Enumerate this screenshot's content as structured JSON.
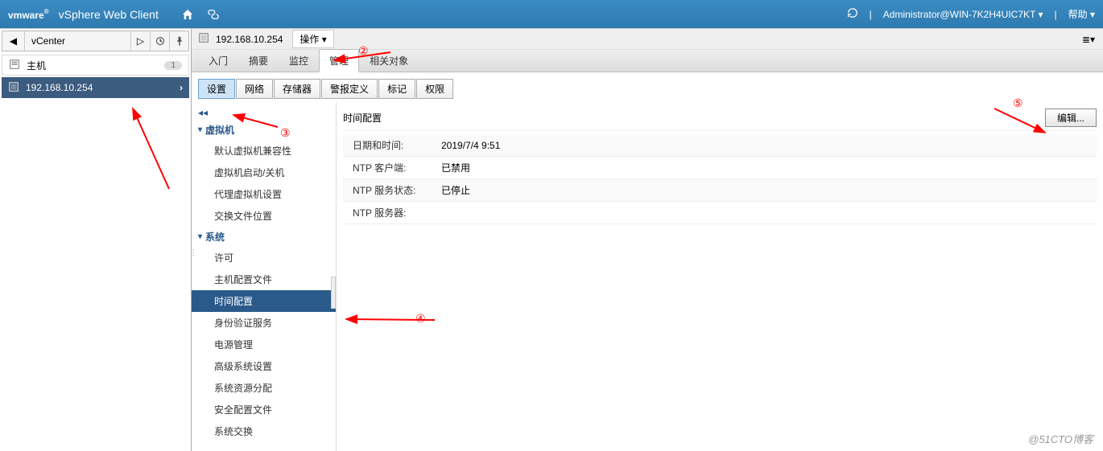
{
  "header": {
    "logo": "vmware",
    "product": "vSphere Web Client",
    "user": "Administrator@WIN-7K2H4UIC7KT",
    "help": "帮助"
  },
  "sidebar": {
    "nav_context": "vCenter",
    "host_label": "主机",
    "host_count": "1",
    "selected_ip": "192.168.10.254"
  },
  "content": {
    "host_ip": "192.168.10.254",
    "actions_label": "操作",
    "main_tabs": {
      "getting_started": "入门",
      "summary": "摘要",
      "monitor": "监控",
      "manage": "管理",
      "related": "相关对象"
    },
    "sub_tabs": {
      "settings": "设置",
      "networking": "网络",
      "storage": "存储器",
      "alarm": "警报定义",
      "tags": "标记",
      "permissions": "权限"
    }
  },
  "settings_nav": {
    "vm_group": "虚拟机",
    "vm_items": {
      "default_compat": "默认虚拟机兼容性",
      "startup": "虚拟机启动/关机",
      "agent": "代理虚拟机设置",
      "swap": "交换文件位置"
    },
    "sys_group": "系统",
    "sys_items": {
      "licensing": "许可",
      "host_profile": "主机配置文件",
      "time_config": "时间配置",
      "auth_services": "身份验证服务",
      "power_mgmt": "电源管理",
      "advanced": "高级系统设置",
      "resource_alloc": "系统资源分配",
      "security_profile": "安全配置文件",
      "system_swap": "系统交换"
    }
  },
  "detail": {
    "title": "时间配置",
    "edit_label": "编辑...",
    "rows": {
      "datetime_label": "日期和时间:",
      "datetime_value": "2019/7/4 9:51",
      "ntp_client_label": "NTP 客户端:",
      "ntp_client_value": "已禁用",
      "ntp_status_label": "NTP 服务状态:",
      "ntp_status_value": "已停止",
      "ntp_servers_label": "NTP 服务器:",
      "ntp_servers_value": ""
    }
  },
  "annotations": {
    "n2": "②",
    "n3": "③",
    "n4": "④",
    "n5": "⑤"
  },
  "watermark": "@51CTO博客"
}
